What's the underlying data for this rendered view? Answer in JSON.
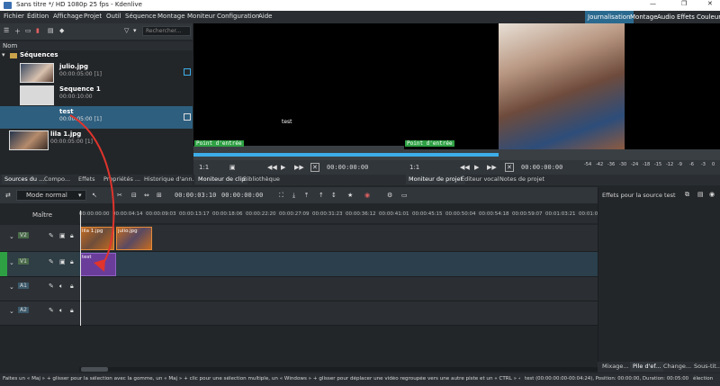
{
  "window": {
    "title": "Sans titre */ HD 1080p 25 fps - Kdenlive",
    "minimize": "—",
    "maximize": "❐",
    "close": "✕"
  },
  "menu": [
    "Fichier",
    "Édition",
    "Affichage",
    "Projet",
    "Outil",
    "Séquence",
    "Montage",
    "Moniteur",
    "Configuration",
    "Aide"
  ],
  "workspaces": [
    "Journalisation",
    "Montage",
    "Audio",
    "Effets",
    "Couleur"
  ],
  "bin": {
    "search_placeholder": "Rechercher...",
    "column_header": "Nom",
    "folder": "Séquences",
    "items": [
      {
        "name": "julio.jpg",
        "info": "00:00:05:00 [1]"
      },
      {
        "name": "Sequence 1",
        "info": "00:00:10:00"
      },
      {
        "name": "test",
        "info": "00:00:05:00 [1]"
      },
      {
        "name": "lila 1.jpg",
        "info": "00:00:05:00 [1]"
      }
    ]
  },
  "clip_monitor": {
    "overlay_text": "test",
    "in_point": "Point d'entrée",
    "zoom": "1:1",
    "timecode": "00:00:00:00",
    "tabs": [
      "Moniteur de clip",
      "Bibliothèque"
    ]
  },
  "project_monitor": {
    "in_point": "Point d'entrée",
    "zoom": "1:1",
    "timecode": "00:00:00:00",
    "tabs": [
      "Moniteur de projet",
      "Éditeur vocal",
      "Notes de projet"
    ]
  },
  "audio_meter": [
    "-54",
    "-42",
    "-36",
    "-30",
    "-24",
    "-18",
    "-15",
    "-12",
    "-9",
    "-6",
    "-3",
    "0"
  ],
  "left_tabs": [
    "Sources du ...",
    "Compo...",
    "Effets",
    "Propriétés ...",
    "Historique d'ann..."
  ],
  "timeline_toolbar": {
    "mode": "Mode normal",
    "position": "00:00:03:10",
    "duration": "00:00:00:00"
  },
  "timeline": {
    "master_label": "Maître",
    "ruler": [
      "00:00:00:00",
      "00:00:04:14",
      "00:00:09:03",
      "00:00:13:17",
      "00:00:18:06",
      "00:00:22:20",
      "00:00:27:09",
      "00:00:31:23",
      "00:00:36:12",
      "00:00:41:01",
      "00:00:45:15",
      "00:00:50:04",
      "00:00:54:18",
      "00:00:59:07",
      "00:01:03:21",
      "00:01:0"
    ],
    "tracks": [
      {
        "label": "V2",
        "kind": "video"
      },
      {
        "label": "V1",
        "kind": "video"
      },
      {
        "label": "A1",
        "kind": "audio"
      },
      {
        "label": "A2",
        "kind": "audio"
      }
    ],
    "clips": {
      "v2_a": "lila 1.jpg",
      "v2_b": "julio.jpg",
      "v1": "test"
    }
  },
  "effects_panel": {
    "title": "Effets pour la source test",
    "tabs": [
      "Mixage...",
      "Pile d'ef...",
      "Change...",
      "Sous-tit..."
    ]
  },
  "statusbar": {
    "hint": "Faites un « Maj » + glisser pour la sélection avec la gomme, un « Maj » + clic pour une sélection multiple, un « Windows » + glisser pour déplacer une vidéo regroupée vers une autre piste et un « CTRL » + glis",
    "info": "test (00:00:00:00-00:04:24), Position: 00:00:00, Duration: 00:05:00",
    "mode": "élection"
  },
  "colors": {
    "accent": "#3daee9",
    "selected": "#2e5f7f",
    "clip_purple": "#6a3d9a",
    "clip_orange": "#c46a1f",
    "arrow": "#e0342c",
    "green_label": "#2ea043"
  }
}
